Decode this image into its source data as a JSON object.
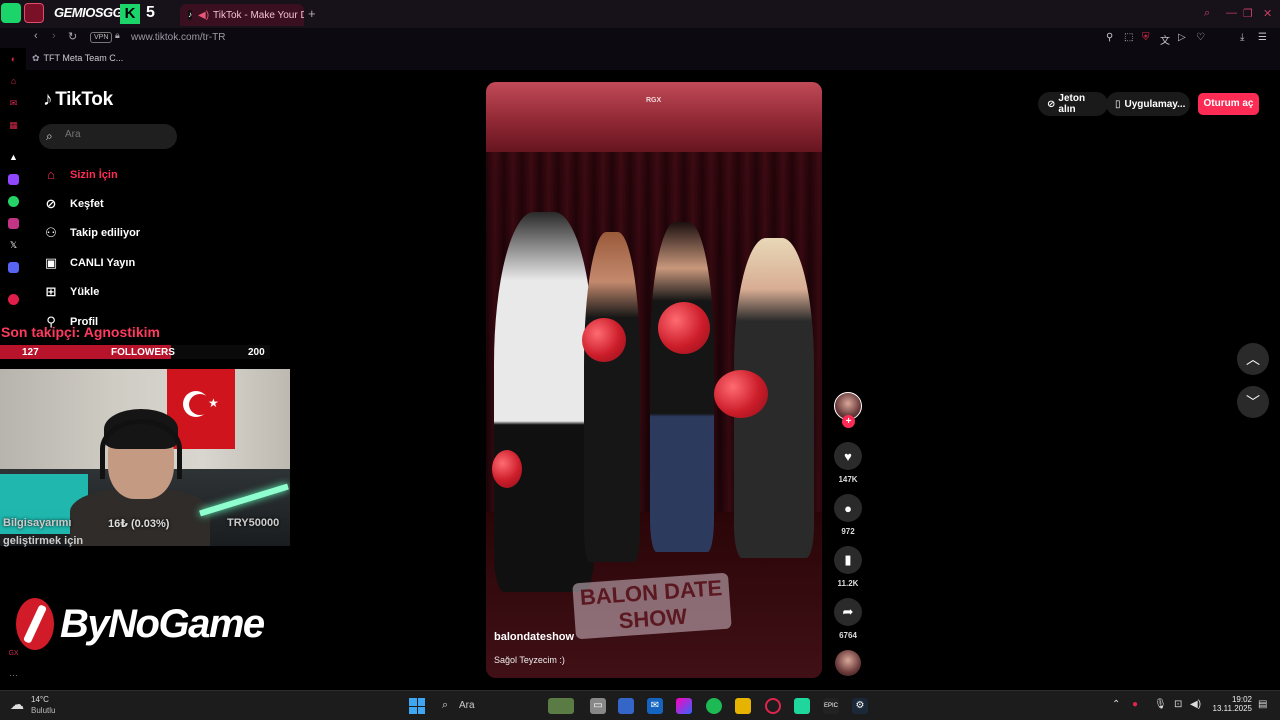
{
  "browser": {
    "tab_overlay_logo": "GEMIOSGG",
    "tab_overlay_count": "5",
    "active_tab_title": "TikTok - Make Your D",
    "new_tab": "+",
    "url": "www.tiktok.com/tr-TR",
    "vpn_label": "VPN",
    "bookmark": "TFT Meta Team C..."
  },
  "tiktok": {
    "logo": "TikTok",
    "search_placeholder": "Ara",
    "nav": [
      {
        "label": "Sizin İçin",
        "icon": "home-icon"
      },
      {
        "label": "Keşfet",
        "icon": "compass-icon"
      },
      {
        "label": "Takip ediliyor",
        "icon": "following-icon"
      },
      {
        "label": "CANLI Yayın",
        "icon": "live-icon"
      },
      {
        "label": "Yükle",
        "icon": "upload-icon"
      },
      {
        "label": "Profil",
        "icon": "profile-icon"
      }
    ],
    "top_right": {
      "coins": "Jeton alın",
      "app": "Uygulamay...",
      "login": "Oturum aç"
    },
    "video": {
      "watermark": "RGX",
      "show_title_1": "BALON DATE",
      "show_title_2": "SHOW",
      "creator": "balondateshow",
      "caption": "Sağol Teyzecim :)"
    },
    "actions": {
      "likes": "147K",
      "comments": "972",
      "saves": "11.2K",
      "shares": "6764"
    }
  },
  "overlay": {
    "last_follower": "Son takipçi: Agnostikim",
    "followers_current": "127",
    "followers_label": "FOLLOWERS",
    "followers_goal": "200",
    "followers_progress": 0.635,
    "donate_title": "Bilgisayarımı",
    "donate_amount": "16₺ (0.03%)",
    "donate_goal": "TRY50000",
    "donate_sub": "geliştirmek için",
    "sponsor": "ByNoGame"
  },
  "taskbar": {
    "temperature": "14°C",
    "condition": "Bulutlu",
    "search": "Ara",
    "time": "19:02",
    "date": "13.11.2025"
  }
}
